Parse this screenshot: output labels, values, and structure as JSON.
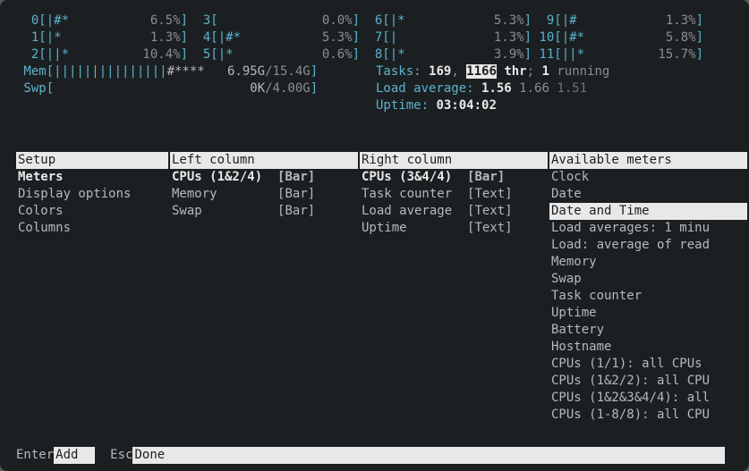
{
  "cpus": [
    [
      {
        "id": "0",
        "fill": "|#*",
        "pct": "6.5%"
      },
      {
        "id": "3",
        "fill": "",
        "pct": "0.0%"
      },
      {
        "id": "6",
        "fill": "|*",
        "pct": "5.3%"
      },
      {
        "id": "9",
        "fill": "|#",
        "pct": "1.3%"
      }
    ],
    [
      {
        "id": "1",
        "fill": "|*",
        "pct": "1.3%"
      },
      {
        "id": "4",
        "fill": "|#*",
        "pct": "5.3%"
      },
      {
        "id": "7",
        "fill": "|",
        "pct": "1.3%"
      },
      {
        "id": "10",
        "fill": "|#*",
        "pct": "5.8%"
      }
    ],
    [
      {
        "id": "2",
        "fill": "||*",
        "pct": "10.4%"
      },
      {
        "id": "5",
        "fill": "|*",
        "pct": "0.6%"
      },
      {
        "id": "8",
        "fill": "|*",
        "pct": "3.9%"
      },
      {
        "id": "11",
        "fill": "||*",
        "pct": "15.7%"
      }
    ]
  ],
  "mem": {
    "label": "Mem",
    "bars": "|||||||||||||||",
    "buf": "#****",
    "used": "6.95G",
    "total": "/15.4G"
  },
  "swp": {
    "label": "Swp",
    "bars": "",
    "buf": "",
    "used": "0K",
    "total": "/4.00G"
  },
  "tasks": {
    "label": "Tasks: ",
    "procs": "169",
    "sep": ", ",
    "threads": "1166",
    "thr": " thr",
    "semi": "; ",
    "running": "1",
    "runtxt": " running"
  },
  "loadavg": {
    "label": "Load average: ",
    "v1": "1.56",
    "v2": " 1.66",
    "v3": " 1.51"
  },
  "uptime": {
    "label": "Uptime: ",
    "value": "03:04:02"
  },
  "setup": {
    "title": "Setup",
    "items": [
      "Meters",
      "Display options",
      "Colors",
      "Columns"
    ],
    "selected": 0
  },
  "left": {
    "title": "Left column",
    "items": [
      {
        "name": "CPUs (1&2/4)",
        "fmt": "[Bar]",
        "bold": true
      },
      {
        "name": "Memory",
        "fmt": "[Bar]",
        "bold": false
      },
      {
        "name": "Swap",
        "fmt": "[Bar]",
        "bold": false
      }
    ]
  },
  "right": {
    "title": "Right column",
    "items": [
      {
        "name": "CPUs (3&4/4)",
        "fmt": "[Bar]",
        "bold": true
      },
      {
        "name": "Task counter",
        "fmt": "[Text]",
        "bold": false
      },
      {
        "name": "Load average",
        "fmt": "[Text]",
        "bold": false
      },
      {
        "name": "Uptime",
        "fmt": "[Text]",
        "bold": false
      }
    ]
  },
  "avail": {
    "title": "Available meters",
    "items": [
      "Clock",
      "Date",
      "Date and Time",
      "Load averages: 1 minu",
      "Load: average of read",
      "Memory",
      "Swap",
      "Task counter",
      "Uptime",
      "Battery",
      "Hostname",
      "CPUs (1/1): all CPUs",
      "CPUs (1&2/2): all CPU",
      "CPUs (1&2&3&4/4): all",
      "CPUs (1-8/8): all CPU"
    ],
    "selected": 2
  },
  "footer": {
    "k1": "Enter",
    "b1": "Add  ",
    "k2": "Esc",
    "b2": "Done                                                                          "
  }
}
